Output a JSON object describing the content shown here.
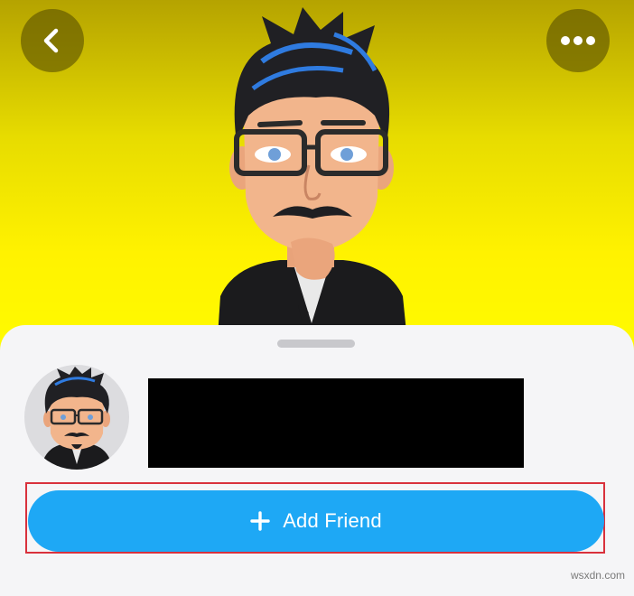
{
  "header": {
    "back_icon": "chevron-left-icon",
    "more_icon": "ellipsis-icon",
    "background_color": "#fff200"
  },
  "profile": {
    "avatar": "bitmoji-avatar",
    "name": ""
  },
  "actions": {
    "add_friend_label": "Add Friend",
    "add_friend_icon": "plus-icon",
    "button_color": "#1ea8f5",
    "highlight_color": "#d9313c"
  },
  "watermark": {
    "text": "wsxdn.com"
  }
}
